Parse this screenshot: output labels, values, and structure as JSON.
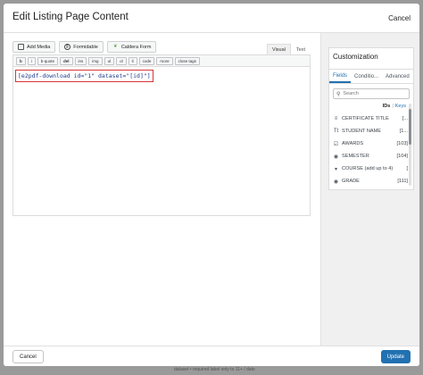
{
  "modal": {
    "title": "Edit Listing Page Content",
    "close_label": "Cancel"
  },
  "media_buttons": [
    {
      "label": "Add Media",
      "icon": "media-icon"
    },
    {
      "label": "Formidable",
      "icon": "formidable-icon"
    },
    {
      "label": "Caldera Form",
      "icon": "caldera-icon"
    }
  ],
  "editor_tabs": {
    "visual": "Visual",
    "text": "Text",
    "active": "text"
  },
  "quicktags": [
    "b",
    "i",
    "b-quote",
    "del",
    "ins",
    "img",
    "ul",
    "ol",
    "li",
    "code",
    "more",
    "close tags"
  ],
  "editor": {
    "content": "[e2pdf-download id=\"1\" dataset=\"[id]\"]"
  },
  "customization": {
    "title": "Customization",
    "tabs": [
      "Fields",
      "Conditio...",
      "Advanced"
    ],
    "active_tab": "Fields",
    "search_placeholder": "Search",
    "ids_label": "IDs",
    "separator": "|",
    "keys_label": "Keys",
    "fields": [
      {
        "icon": "list-icon",
        "label": "CERTIFICATE TITLE",
        "id": "[..."
      },
      {
        "icon": "text-icon",
        "label": "STUDENT NAME",
        "id": "[1..."
      },
      {
        "icon": "checkbox-icon",
        "label": "AWARDS",
        "id": "[103]"
      },
      {
        "icon": "radio-icon",
        "label": "SEMESTER",
        "id": "[104]"
      },
      {
        "icon": "chevron-icon",
        "label": "COURSE (add up to 4)",
        "id": "["
      },
      {
        "icon": "radio-icon",
        "label": "GRADE",
        "id": "[111]"
      }
    ]
  },
  "footer": {
    "cancel_label": "Cancel",
    "update_label": "Update"
  },
  "background_text": "dataset • required label only to 11+ / date"
}
